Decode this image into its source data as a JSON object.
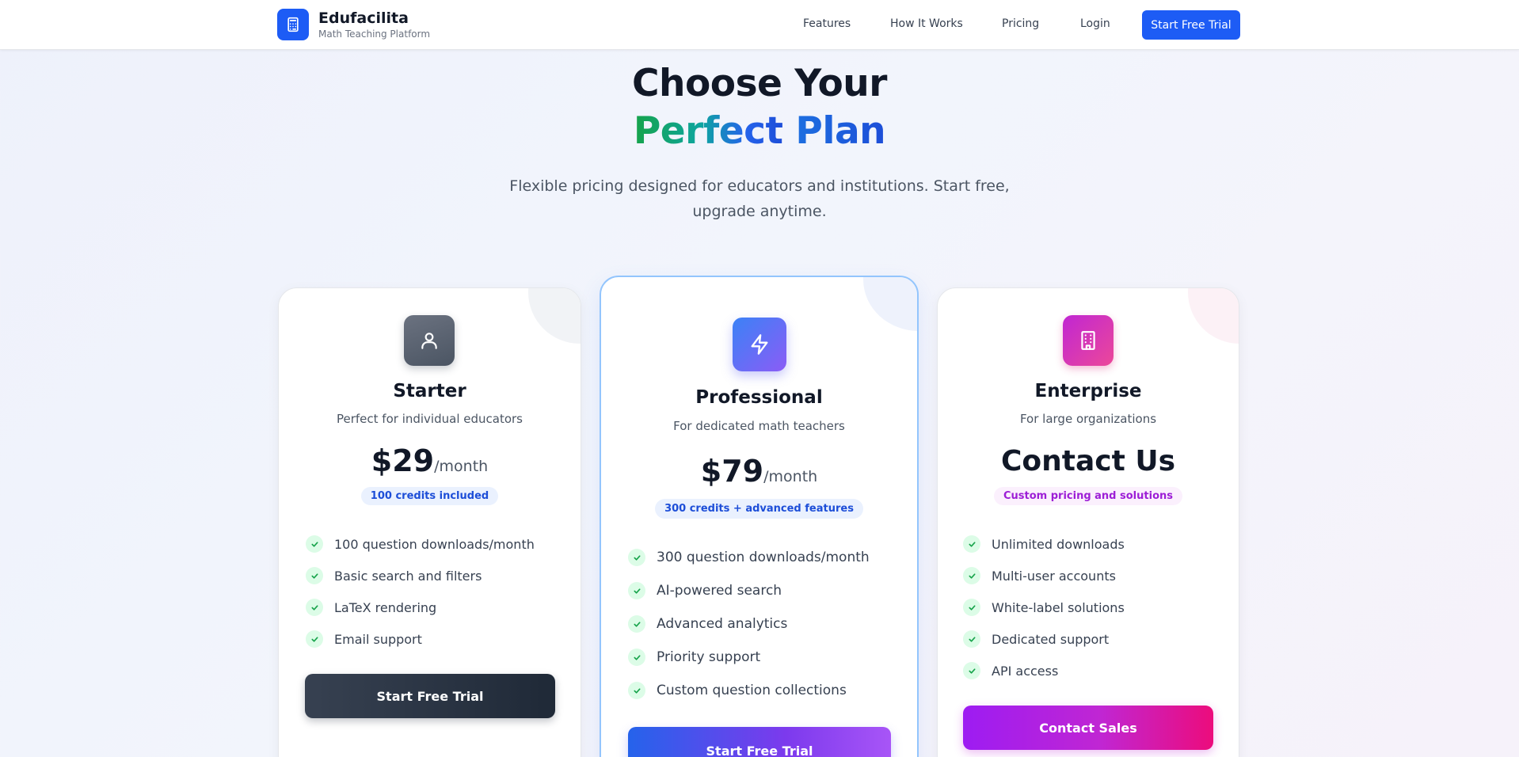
{
  "header": {
    "brand_name": "Edufacilita",
    "brand_tagline": "Math Teaching Platform",
    "nav": [
      "Features",
      "How It Works",
      "Pricing",
      "Login"
    ],
    "cta_label": "Start Free Trial",
    "accent_color": "#1d5cf5"
  },
  "hero": {
    "title_line1": "Choose Your",
    "title_line2_word1": "Perfect",
    "title_line2_word2": "Plan",
    "subtitle": "Flexible pricing designed for educators and institutions. Start free, upgrade anytime."
  },
  "plans": [
    {
      "icon": "user-icon",
      "name": "Starter",
      "description": "Perfect for individual educators",
      "price": "$29",
      "period": "/month",
      "badge": "100 credits included",
      "features": [
        "100 question downloads/month",
        "Basic search and filters",
        "LaTeX rendering",
        "Email support"
      ],
      "button_label": "Start Free Trial"
    },
    {
      "icon": "lightning-icon",
      "name": "Professional",
      "description": "For dedicated math teachers",
      "price": "$79",
      "period": "/month",
      "badge": "300 credits + advanced features",
      "features": [
        "300 question downloads/month",
        "AI-powered search",
        "Advanced analytics",
        "Priority support",
        "Custom question collections"
      ],
      "button_label": "Start Free Trial"
    },
    {
      "icon": "building-icon",
      "name": "Enterprise",
      "description": "For large organizations",
      "price": "Contact Us",
      "badge": "Custom pricing and solutions",
      "features": [
        "Unlimited downloads",
        "Multi-user accounts",
        "White-label solutions",
        "Dedicated support",
        "API access"
      ],
      "button_label": "Contact Sales"
    }
  ]
}
